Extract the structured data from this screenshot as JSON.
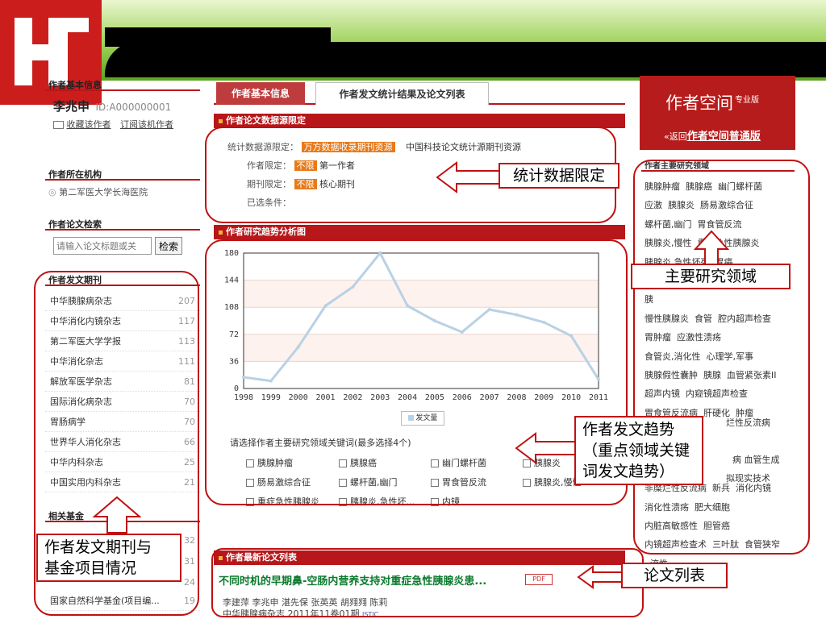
{
  "left": {
    "basic_info_title": "作者基本信息",
    "author_name": "李兆申",
    "author_id": "ID:A000000001",
    "collect_link": "收藏该作者",
    "subscribe_link": "订阅该机作者",
    "org_title": "作者所在机构",
    "org_name": "第二军医大学长海医院",
    "search_title": "作者论文检索",
    "search_placeholder": "请输入论文标题或关",
    "search_button": "检索",
    "journals_title": "作者发文期刊",
    "journals": [
      {
        "name": "中华胰腺病杂志",
        "count": "207"
      },
      {
        "name": "中华消化内镜杂志",
        "count": "117"
      },
      {
        "name": "第二军医大学学报",
        "count": "113"
      },
      {
        "name": "中华消化杂志",
        "count": "111"
      },
      {
        "name": "解放军医学杂志",
        "count": "81"
      },
      {
        "name": "国际消化病杂志",
        "count": "70"
      },
      {
        "name": "胃肠病学",
        "count": "70"
      },
      {
        "name": "世界华人消化杂志",
        "count": "66"
      },
      {
        "name": "中华内科杂志",
        "count": "25"
      },
      {
        "name": "中国实用内科杂志",
        "count": "21"
      }
    ],
    "fund_title": "相关基金",
    "fund_counts": [
      "32",
      "31",
      "24"
    ],
    "fund_last": "国家自然科学基金(项目编...",
    "fund_last_count": "19"
  },
  "tabs": [
    "作者基本信息",
    "作者发文统计结果及论文列表"
  ],
  "source": {
    "bar_title": "作者论文数据源限定",
    "row1_label": "统计数据源限定：",
    "row1_tag": "万方数据收录期刊资源",
    "row1_value": "中国科技论文统计源期刊资源",
    "row2_label": "作者限定：",
    "row2_tag": "不限",
    "row2_value": "第一作者",
    "row3_label": "期刊限定：",
    "row3_tag": "不限",
    "row3_value": "核心期刊",
    "row4_label": "已选条件："
  },
  "trend": {
    "bar_title": "作者研究趋势分析图",
    "legend": "发文量",
    "keyword_prompt": "请选择作者主要研究领域关键词(最多选择4个)",
    "keywords": [
      "胰腺肿瘤",
      "胰腺癌",
      "幽门螺杆菌",
      "胰腺炎",
      "肠易激综合征",
      "螺杆菌,幽门",
      "胃食管反流",
      "胰腺炎,慢性",
      "重症急性胰腺炎",
      "胰腺炎,急性坏...",
      "内镜"
    ]
  },
  "chart_data": {
    "type": "line",
    "x": [
      "1998",
      "1999",
      "2000",
      "2001",
      "2002",
      "2003",
      "2004",
      "2005",
      "2006",
      "2007",
      "2008",
      "2009",
      "2010",
      "2011"
    ],
    "series": [
      {
        "name": "发文量",
        "values": [
          15,
          10,
          55,
          110,
          135,
          180,
          110,
          90,
          75,
          105,
          98,
          88,
          70,
          12
        ]
      }
    ],
    "y_ticks": [
      "0",
      "36",
      "72",
      "108",
      "144",
      "180"
    ],
    "ylim": [
      0,
      180
    ],
    "grid": true,
    "legend_placement": "bottom"
  },
  "papers": {
    "bar_title": "作者最新论文列表",
    "title": "不同时机的早期鼻-空肠内营养支持对重症急性胰腺炎患...",
    "pdf_label": "PDF",
    "authors": "李建萍 李兆申 湛先保 张英英 胡翙翙 陈莉",
    "source": "中华胰腺病杂志 2011年11卷01期",
    "istic": "ISTIC"
  },
  "right": {
    "space_title": "作者空间",
    "space_tag": "专业版",
    "back_prefix": "«返回",
    "back_link": "作者空间普通版",
    "areas_title": "作者主要研究领域",
    "areas_lines": [
      "胰腺肿瘤  胰腺癌  幽门螺杆菌",
      "应激  胰腺炎  肠易激综合征",
      "螺杆菌,幽门  胃食管反流",
      "胰腺炎,慢性  重症急性胰腺炎",
      "胰腺炎,急性坏死  胃癌",
      "急",
      "胰",
      "慢性胰腺炎  食管  腔内超声检查",
      "胃肿瘤  应激性溃疡",
      "食管炎,消化性  心理学,军事",
      "胰腺假性囊肿  胰腺  血管紧张素II",
      "超声内镜  内窥镜超声检查",
      "胃食管反流病  肝硬化  肿瘤",
      "",
      "",
      "",
      "非糜烂性反流病  新兵  消化内镜",
      "消化性溃疡  肥大细胞",
      "内脏高敏感性  胆管癌",
      "内镜超声检查术  三叶肽  食管狭窄",
      "  流性"
    ],
    "area_extra1": "烂性反流病",
    "area_extra2": "病  血管生成",
    "area_extra3": "拟现实技术"
  },
  "callouts": {
    "source_limit": "统计数据限定",
    "main_areas": "主要研究领域",
    "trend": "作者发文趋势\n（重点领域关键\n词发文趋势）",
    "journals": "作者发文期刊与\n基金项目情况",
    "paper_list": "论文列表"
  },
  "colors": {
    "accent_red": "#b7171a",
    "callout_red": "#c01010",
    "tag_orange": "#e87a1a",
    "chart_line": "#b9d1e4"
  }
}
